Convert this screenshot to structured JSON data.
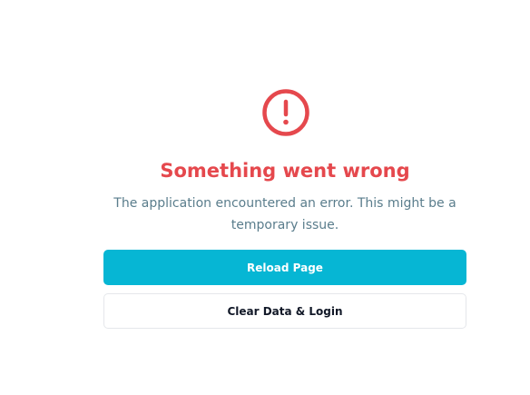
{
  "error": {
    "icon": "alert-circle-icon",
    "accent_color": "#e5484d",
    "title": "Something went wrong",
    "message": "The application encountered an error. This might be a temporary issue."
  },
  "actions": {
    "reload_label": "Reload Page",
    "clear_label": "Clear Data & Login",
    "primary_color": "#06b6d4"
  }
}
